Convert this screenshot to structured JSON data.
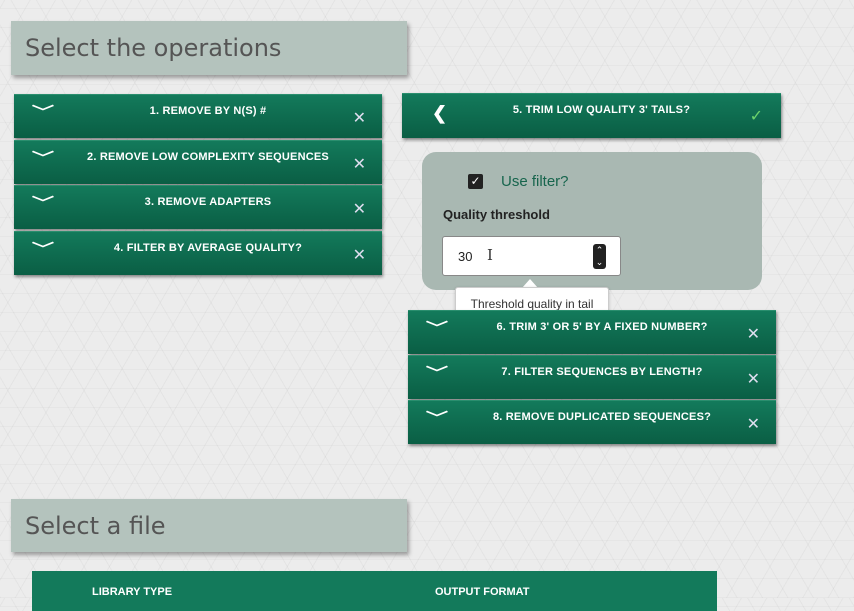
{
  "operations_section": {
    "title": "Select the operations"
  },
  "operations_left": [
    {
      "label": "1. REMOVE BY N(S) #",
      "expand_icon": "chevron-down-icon",
      "action_icon": "close-icon",
      "action_glyph": "✕"
    },
    {
      "label": "2. REMOVE LOW COMPLEXITY SEQUENCES",
      "expand_icon": "chevron-down-icon",
      "action_icon": "close-icon",
      "action_glyph": "✕"
    },
    {
      "label": "3. REMOVE ADAPTERS",
      "expand_icon": "chevron-down-icon",
      "action_icon": "close-icon",
      "action_glyph": "✕"
    },
    {
      "label": "4. FILTER BY AVERAGE QUALITY?",
      "expand_icon": "chevron-down-icon",
      "action_icon": "close-icon",
      "action_glyph": "✕"
    }
  ],
  "active_operation": {
    "label": "5. TRIM LOW QUALITY 3' TAILS?",
    "back_icon": "chevron-left-icon",
    "back_glyph": "❮",
    "status_icon": "checkmark-icon",
    "status_glyph": "✓",
    "use_filter_label": "Use filter?",
    "use_filter_checked": true,
    "checkbox_glyph": "✓",
    "quality_threshold_label": "Quality threshold",
    "quality_threshold_value": "30",
    "spinner_up": "⌃",
    "spinner_down": "⌄",
    "text_cursor_glyph": "I",
    "tooltip": "Threshold quality in tail"
  },
  "operations_right": [
    {
      "label": "6. TRIM 3' OR 5' BY A FIXED NUMBER?",
      "expand_icon": "chevron-down-icon",
      "action_icon": "close-icon",
      "action_glyph": "✕"
    },
    {
      "label": "7. FILTER SEQUENCES BY LENGTH?",
      "expand_icon": "chevron-down-icon",
      "action_icon": "close-icon",
      "action_glyph": "✕"
    },
    {
      "label": "8. REMOVE DUPLICATED SEQUENCES?",
      "expand_icon": "chevron-down-icon",
      "action_icon": "close-icon",
      "action_glyph": "✕"
    }
  ],
  "chevron_glyph": "﹀",
  "file_section": {
    "title": "Select a file"
  },
  "file_table": {
    "columns": [
      "LIBRARY TYPE",
      "OUTPUT FORMAT"
    ]
  },
  "colors": {
    "bar_green": "#137a5b",
    "panel_gray": "#a9b8b2",
    "header_gray": "#b4c3bd",
    "accent_check": "#6cd46c"
  }
}
